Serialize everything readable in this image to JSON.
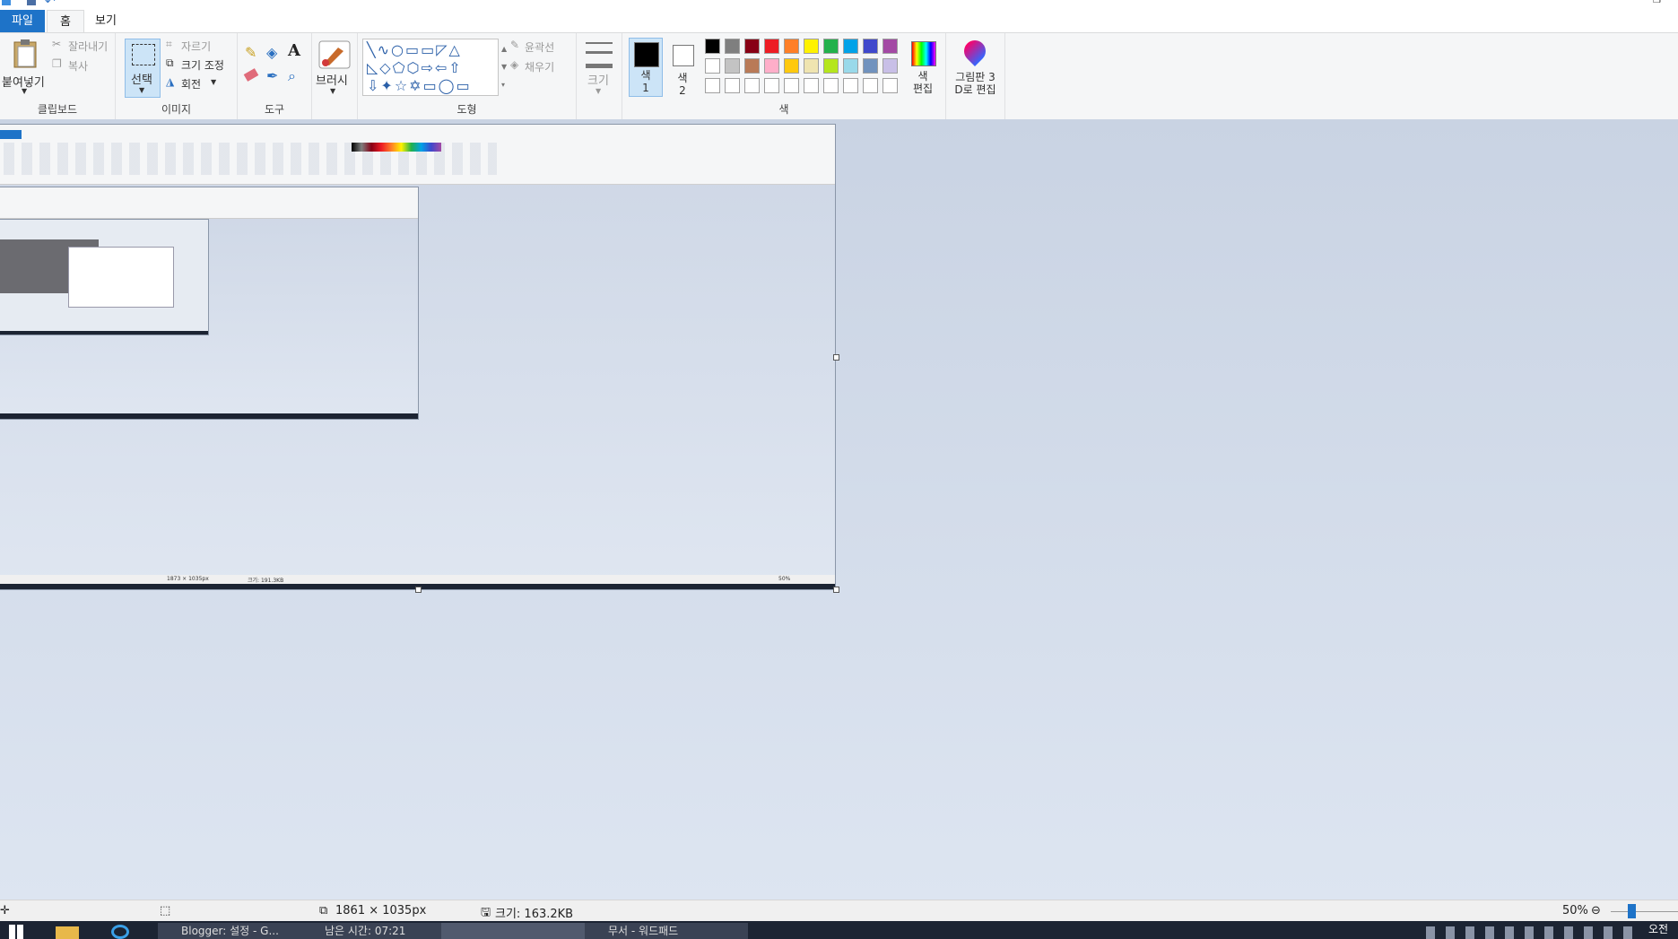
{
  "tabs": {
    "file": "파일",
    "home": "홈",
    "view": "보기"
  },
  "ribbon": {
    "clipboard": {
      "paste": "붙여넣기",
      "cut": "잘라내기",
      "copy": "복사",
      "label": "클립보드"
    },
    "image": {
      "select": "선택",
      "crop": "자르기",
      "resize": "크기 조정",
      "rotate": "회전",
      "label": "이미지"
    },
    "tools": {
      "label": "도구"
    },
    "brushes": {
      "label": "브러시"
    },
    "shapes": {
      "outline": "윤곽선",
      "fill": "채우기",
      "label": "도형"
    },
    "size": {
      "label": "크기"
    },
    "colors": {
      "color1": "색\n1",
      "color2": "색\n2",
      "edit": "색\n편집",
      "label": "색",
      "row1": [
        "#000000",
        "#7f7f7f",
        "#880015",
        "#ed1c24",
        "#ff7f27",
        "#fff200",
        "#22b14c",
        "#00a2e8",
        "#3f48cc",
        "#a349a4"
      ],
      "row2": [
        "#ffffff",
        "#c3c3c3",
        "#b97a57",
        "#ffaec9",
        "#ffc90e",
        "#efe4b0",
        "#b5e61d",
        "#99d9ea",
        "#7092be",
        "#c8bfe7"
      ]
    },
    "paint3d": "그림판 3\nD로 편집"
  },
  "status": {
    "dimensions": "1861 × 1035px",
    "size": "크기: 163.2KB",
    "zoom": "50%"
  },
  "nested": {
    "dims": "1873 × 1035px",
    "size": "크기: 191.3KB",
    "zoom": "50%"
  },
  "taskbar": {
    "chrome": "Blogger: 설정 - G...",
    "timer": "남은 시간: 07:21",
    "paint": "",
    "notepad": "무서 - 워드패드",
    "clock": "오전"
  }
}
